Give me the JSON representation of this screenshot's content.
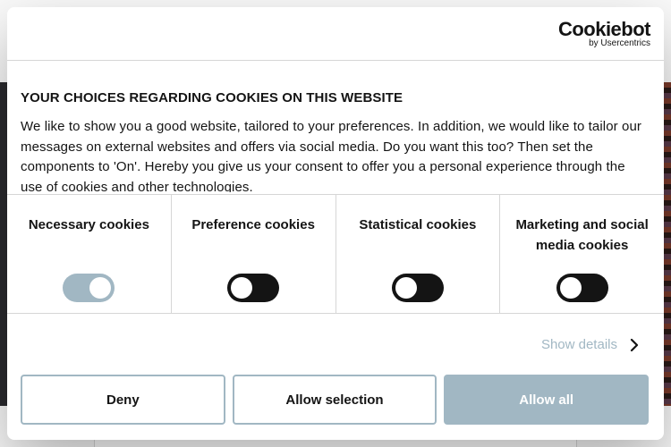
{
  "logo": {
    "name": "Cookiebot",
    "byline": "by Usercentrics"
  },
  "banner": {
    "title": "YOUR CHOICES REGARDING COOKIES ON THIS WEBSITE",
    "body": "We like to show you a good website, tailored to your preferences. In addition, we would like to tailor our messages on external websites and offers via social media. Do you want this too? Then set the components to 'On'. Hereby you give us your consent to offer you a personal experience through the use of cookies and other technologies."
  },
  "categories": [
    {
      "label": "Necessary cookies",
      "enabled": true,
      "locked": true
    },
    {
      "label": "Preference cookies",
      "enabled": false
    },
    {
      "label": "Statistical cookies",
      "enabled": false
    },
    {
      "label": "Marketing and social media cookies",
      "enabled": false
    }
  ],
  "details_link": "Show details",
  "buttons": {
    "deny": "Deny",
    "allow_selection": "Allow selection",
    "allow_all": "Allow all"
  },
  "colors": {
    "accent": "#a1b7c3",
    "text": "#141414",
    "toggle_off": "#141414"
  }
}
